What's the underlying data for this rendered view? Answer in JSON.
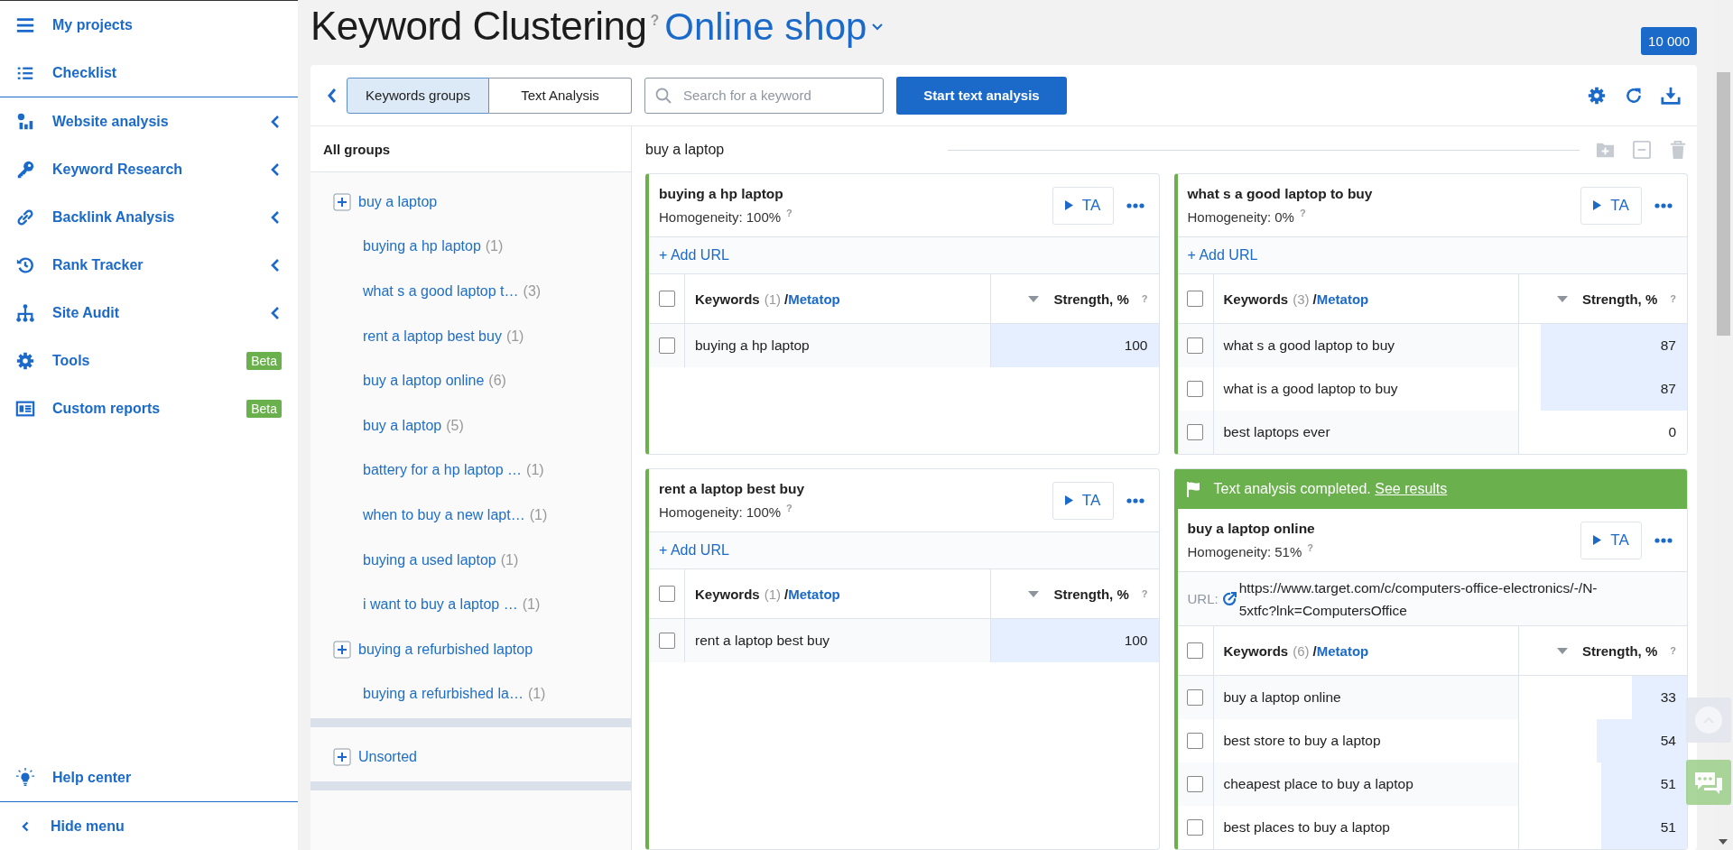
{
  "sidebar": {
    "top": [
      {
        "label": "My projects"
      },
      {
        "label": "Checklist"
      }
    ],
    "main": [
      {
        "label": "Website analysis",
        "submenu": true
      },
      {
        "label": "Keyword Research",
        "submenu": true
      },
      {
        "label": "Backlink Analysis",
        "submenu": true
      },
      {
        "label": "Rank Tracker",
        "submenu": true
      },
      {
        "label": "Site Audit",
        "submenu": true
      },
      {
        "label": "Tools",
        "submenu": false,
        "badge": "Beta"
      },
      {
        "label": "Custom reports",
        "submenu": false,
        "badge": "Beta"
      }
    ],
    "bottom": [
      {
        "label": "Help center"
      }
    ],
    "hide": {
      "label": "Hide menu"
    }
  },
  "header": {
    "title": "Keyword Clustering",
    "help": "?",
    "project": "Online shop",
    "balance": "10 000"
  },
  "toolbar": {
    "tabs": [
      {
        "label": "Keywords groups",
        "selected": true
      },
      {
        "label": "Text Analysis",
        "selected": false
      }
    ],
    "search": {
      "placeholder": "Search for a keyword"
    },
    "start_button": "Start text analysis"
  },
  "groups": {
    "title": "All groups",
    "sections": [
      {
        "groups": [
          {
            "label": "buy a laptop",
            "children": [
              {
                "label": "buying a hp laptop",
                "count": "(1)"
              },
              {
                "label": "what s a good laptop t…",
                "count": "(3)"
              },
              {
                "label": "rent a laptop best buy",
                "count": "(1)"
              },
              {
                "label": "buy a laptop online",
                "count": "(6)"
              },
              {
                "label": "buy a laptop",
                "count": "(5)"
              },
              {
                "label": "battery for a hp laptop …",
                "count": "(1)"
              },
              {
                "label": "when to buy a new lapt…",
                "count": "(1)"
              },
              {
                "label": "buying a used laptop",
                "count": "(1)"
              },
              {
                "label": "i want to buy a laptop …",
                "count": "(1)"
              }
            ]
          },
          {
            "label": "buying a refurbished laptop",
            "children": [
              {
                "label": "buying a refurbished la…",
                "count": "(1)"
              }
            ]
          }
        ]
      },
      {
        "groups": [
          {
            "label": "Unsorted"
          }
        ]
      }
    ]
  },
  "content": {
    "group_title": "buy a laptop",
    "group_actions": {
      "disabled": true
    },
    "cards": [
      {
        "title": "buying a hp laptop",
        "homogeneity": "Homogeneity: 100%",
        "help": "?",
        "ta": "TA",
        "add_url": "+ Add URL",
        "table": {
          "checked": false,
          "keywords": "Keywords",
          "count": "(1)",
          "separator": "/",
          "metatop": "Metatop",
          "strength": "Strength, %",
          "help": "?",
          "rows": [
            {
              "keyword": "buying a hp laptop",
              "strength": "100",
              "level": 1,
              "checked": false
            }
          ]
        }
      },
      {
        "title": "what s a good laptop to buy",
        "homogeneity": "Homogeneity: 0%",
        "help": "?",
        "ta": "TA",
        "add_url": "+ Add URL",
        "table": {
          "checked": false,
          "keywords": "Keywords",
          "count": "(3)",
          "separator": "/",
          "metatop": "Metatop",
          "strength": "Strength, %",
          "help": "?",
          "rows": [
            {
              "keyword": "what s a good laptop to buy",
              "strength": "87",
              "level": 0.87,
              "checked": false
            },
            {
              "keyword": "what is a good laptop to buy",
              "strength": "87",
              "level": 0.87,
              "checked": false
            },
            {
              "keyword": "best laptops ever",
              "strength": "0",
              "level": 0,
              "checked": false
            }
          ]
        }
      },
      {
        "title": "rent a laptop best buy",
        "homogeneity": "Homogeneity: 100%",
        "help": "?",
        "ta": "TA",
        "add_url": "+ Add URL",
        "table": {
          "checked": false,
          "keywords": "Keywords",
          "count": "(1)",
          "separator": "/",
          "metatop": "Metatop",
          "strength": "Strength, %",
          "help": "?",
          "rows": [
            {
              "keyword": "rent a laptop best buy",
              "strength": "100",
              "level": 1,
              "checked": false
            }
          ]
        }
      },
      {
        "banner": {
          "text": "Text analysis completed.",
          "link": "See results"
        },
        "title": "buy a laptop online",
        "homogeneity": "Homogeneity: 51%",
        "help": "?",
        "ta": "TA",
        "url_label": "URL:",
        "url": "https://www.target.com/c/computers-office-electronics/-/N-5xtfc?lnk=ComputersOffice",
        "table": {
          "checked": false,
          "keywords": "Keywords",
          "count": "(6)",
          "separator": "/",
          "metatop": "Metatop",
          "strength": "Strength, %",
          "help": "?",
          "rows": [
            {
              "keyword": "buy a laptop online",
              "strength": "33",
              "level": 0.33,
              "checked": false
            },
            {
              "keyword": "best store to buy a laptop",
              "strength": "54",
              "level": 0.54,
              "checked": false
            },
            {
              "keyword": "cheapest place to buy a laptop",
              "strength": "51",
              "level": 0.51,
              "checked": false
            },
            {
              "keyword": "best places to buy a laptop",
              "strength": "51",
              "level": 0.51,
              "checked": false
            }
          ]
        }
      }
    ]
  }
}
